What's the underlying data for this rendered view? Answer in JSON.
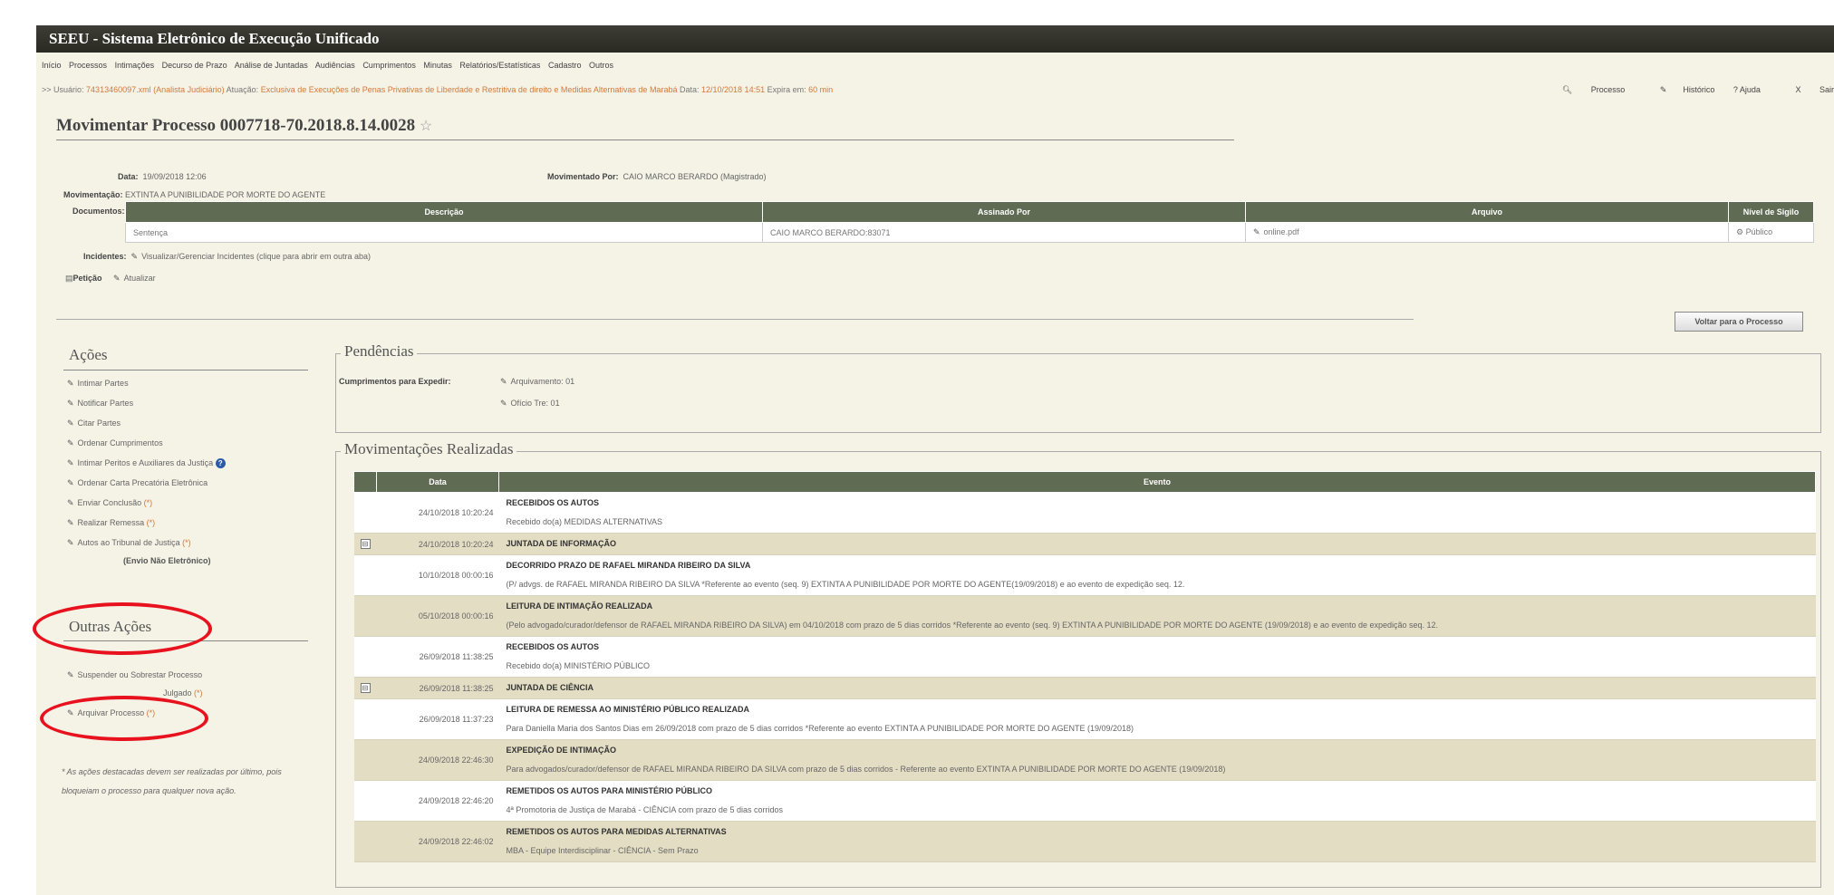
{
  "app": {
    "title": "SEEU - Sistema Eletrônico de Execução Unificado"
  },
  "menu": [
    "Início",
    "Processos",
    "Intimações",
    "Decurso de Prazo",
    "Análise de Juntadas",
    "Audiências",
    "Cumprimentos",
    "Minutas",
    "Relatórios/Estatísticas",
    "Cadastro",
    "Outros"
  ],
  "user": {
    "prefix": ">> Usuário:",
    "name": "74313460097.xml (Analista Judiciário)",
    "atuacao_label": "Atuação:",
    "atuacao": "Exclusiva de Execuções de Penas Privativas de Liberdade e Restritiva de direito e Medidas Alternativas de Marabá",
    "data_label": "Data:",
    "data": "12/10/2018 14:51",
    "expira_label": "Expira em:",
    "expira": "60 min"
  },
  "toplinks": {
    "processo": "Processo",
    "historico": "Histórico",
    "ajuda": "? Ajuda",
    "sair": "Sair"
  },
  "page_title": "Movimentar Processo 0007718-70.2018.8.14.0028",
  "fields": {
    "data_label": "Data:",
    "data_value": "19/09/2018 12:06",
    "mov_por_label": "Movimentado Por:",
    "mov_por_value": "CAIO MARCO BERARDO (Magistrado)",
    "movimentacao_label": "Movimentação:",
    "movimentacao_value": "EXTINTA A PUNIBILIDADE POR MORTE DO AGENTE",
    "documentos_label": "Documentos:",
    "incidentes_label": "Incidentes:",
    "incidentes_value": "Visualizar/Gerenciar Incidentes (clique para abrir em outra aba)",
    "peticao_label": "Petição",
    "atualizar": "Atualizar"
  },
  "doc_table": {
    "headers": [
      "Descrição",
      "Assinado Por",
      "Arquivo",
      "Nível de Sigilo"
    ],
    "row": [
      "Sentença",
      "CAIO MARCO BERARDO:83071",
      "online.pdf",
      "Público"
    ]
  },
  "voltar_button": "Voltar para o Processo",
  "acoes": {
    "title": "Ações",
    "items": [
      "Intimar Partes",
      "Notificar Partes",
      "Citar Partes",
      "Ordenar Cumprimentos",
      "Intimar Peritos e Auxiliares da Justiça",
      "Ordenar Carta Precatória Eletrônica",
      "Enviar Conclusão",
      "Realizar Remessa",
      "Autos ao Tribunal de Justiça"
    ],
    "asterisk": "(*)",
    "envio": "(Envio Não Eletrônico)"
  },
  "outras_acoes": {
    "title": "Outras Ações",
    "items": [
      "Suspender ou Sobrestar Processo",
      "Arquivar Processo"
    ],
    "partial": "Julgado"
  },
  "note": "* As ações destacadas devem ser realizadas por último, pois bloqueiam o processo para qualquer nova ação.",
  "pendencias": {
    "title": "Pendências",
    "label": "Cumprimentos para Expedir:",
    "items": [
      "Arquivamento: 01",
      "Ofício Tre: 01"
    ]
  },
  "movimentacoes": {
    "title": "Movimentações Realizadas",
    "headers": [
      "Data",
      "Evento"
    ],
    "rows": [
      {
        "date": "24/10/2018 10:20:24",
        "title": "RECEBIDOS OS AUTOS",
        "desc": "Recebido do(a) MEDIDAS ALTERNATIVAS",
        "style": "w",
        "check": false
      },
      {
        "date": "24/10/2018 10:20:24",
        "title": "JUNTADA DE INFORMAÇÃO",
        "desc": "",
        "style": "s",
        "check": true
      },
      {
        "date": "10/10/2018 00:00:16",
        "title": "DECORRIDO PRAZO DE RAFAEL MIRANDA RIBEIRO DA SILVA",
        "desc": "(P/ advgs. de RAFAEL MIRANDA RIBEIRO DA SILVA *Referente ao evento (seq. 9) EXTINTA A PUNIBILIDADE POR MORTE DO AGENTE(19/09/2018) e ao evento de expedição seq. 12.",
        "style": "w",
        "check": false
      },
      {
        "date": "05/10/2018 00:00:16",
        "title": "LEITURA DE INTIMAÇÃO REALIZADA",
        "desc": "(Pelo advogado/curador/defensor de RAFAEL MIRANDA RIBEIRO DA SILVA) em 04/10/2018 com prazo de 5 dias corridos *Referente ao evento (seq. 9) EXTINTA A PUNIBILIDADE POR MORTE DO AGENTE (19/09/2018) e ao evento de expedição seq. 12.",
        "style": "t",
        "check": false
      },
      {
        "date": "26/09/2018 11:38:25",
        "title": "RECEBIDOS OS AUTOS",
        "desc": "Recebido do(a) MINISTÉRIO PÚBLICO",
        "style": "w",
        "check": false
      },
      {
        "date": "26/09/2018 11:38:25",
        "title": "JUNTADA DE CIÊNCIA",
        "desc": "",
        "style": "s",
        "check": true
      },
      {
        "date": "26/09/2018 11:37:23",
        "title": "LEITURA DE REMESSA AO MINISTÉRIO PÚBLICO REALIZADA",
        "desc": "Para Daniella Maria dos Santos Dias em 26/09/2018 com prazo de 5 dias corridos *Referente ao evento EXTINTA A PUNIBILIDADE POR MORTE DO AGENTE (19/09/2018)",
        "style": "w",
        "check": false
      },
      {
        "date": "24/09/2018 22:46:30",
        "title": "EXPEDIÇÃO DE INTIMAÇÃO",
        "desc": "Para advogados/curador/defensor de RAFAEL MIRANDA RIBEIRO DA SILVA com prazo de 5 dias corridos - Referente ao evento EXTINTA A PUNIBILIDADE POR MORTE DO AGENTE (19/09/2018)",
        "style": "t",
        "check": false
      },
      {
        "date": "24/09/2018 22:46:20",
        "title": "REMETIDOS OS AUTOS PARA MINISTÉRIO PÚBLICO",
        "desc": "4ª Promotoria de Justiça de Marabá - CIÊNCIA com prazo de 5 dias corridos",
        "style": "w",
        "check": false
      },
      {
        "date": "24/09/2018 22:46:02",
        "title": "REMETIDOS OS AUTOS PARA MEDIDAS ALTERNATIVAS",
        "desc": "MBA - Equipe Interdisciplinar - CIÊNCIA - Sem Prazo",
        "style": "t",
        "check": false
      }
    ]
  },
  "colors": {
    "header_green": "#5f6b52",
    "highlight": "#e8111e",
    "accent_orange": "#d07a3a",
    "page_bg": "#f5f2e6"
  }
}
